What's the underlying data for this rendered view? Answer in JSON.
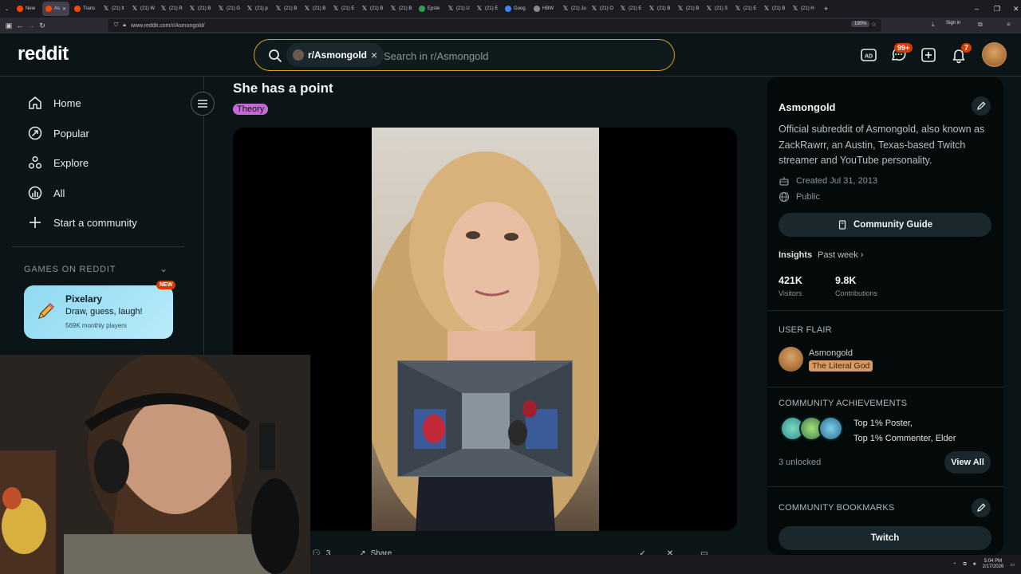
{
  "browser": {
    "tabs": [
      {
        "label": "New",
        "icon": "reddit-icon",
        "color": "#ff4500"
      },
      {
        "label": "As",
        "icon": "reddit-icon",
        "color": "#ff4500",
        "active": true
      },
      {
        "label": "Trans",
        "icon": "reddit-icon",
        "color": "#ff4500"
      },
      {
        "label": "(21) It",
        "icon": "x-icon"
      },
      {
        "label": "(21) W",
        "icon": "x-icon"
      },
      {
        "label": "(21) R",
        "icon": "x-icon"
      },
      {
        "label": "(21) B",
        "icon": "x-icon"
      },
      {
        "label": "(21) G",
        "icon": "x-icon"
      },
      {
        "label": "(21) p",
        "icon": "x-icon"
      },
      {
        "label": "(21) B",
        "icon": "x-icon"
      },
      {
        "label": "(21) B",
        "icon": "x-icon"
      },
      {
        "label": "(21) E",
        "icon": "x-icon"
      },
      {
        "label": "(21) B",
        "icon": "x-icon"
      },
      {
        "label": "(21) B",
        "icon": "x-icon"
      },
      {
        "label": "Epste",
        "icon": "doc-icon",
        "color": "#2e9e4a"
      },
      {
        "label": "(21) U",
        "icon": "x-icon"
      },
      {
        "label": "(21) E",
        "icon": "x-icon"
      },
      {
        "label": "Goog",
        "icon": "google-icon",
        "color": "#4285f4"
      },
      {
        "label": "HBW",
        "icon": "page-icon",
        "color": "#888888"
      },
      {
        "label": "(21) Ju",
        "icon": "x-icon"
      },
      {
        "label": "(21) O",
        "icon": "x-icon"
      },
      {
        "label": "(21) E",
        "icon": "x-icon"
      },
      {
        "label": "(21) B",
        "icon": "x-icon"
      },
      {
        "label": "(21) B",
        "icon": "x-icon"
      },
      {
        "label": "(21) S",
        "icon": "x-icon"
      },
      {
        "label": "(21) E",
        "icon": "x-icon"
      },
      {
        "label": "(21) B",
        "icon": "x-icon"
      },
      {
        "label": "(21) H",
        "icon": "x-icon"
      }
    ],
    "url": "www.reddit.com/r/Asmongold/",
    "zoom": "190%",
    "sign_in": "Sign in"
  },
  "header": {
    "logo": "reddit",
    "search_chip": "r/Asmongold",
    "search_placeholder": "Search in r/Asmongold",
    "chat_badge": "99+",
    "notif_badge": "7"
  },
  "leftnav": {
    "items": [
      {
        "label": "Home",
        "icon": "home-icon"
      },
      {
        "label": "Popular",
        "icon": "popular-icon"
      },
      {
        "label": "Explore",
        "icon": "explore-icon"
      },
      {
        "label": "All",
        "icon": "all-icon"
      },
      {
        "label": "Start a community",
        "icon": "plus-icon"
      }
    ],
    "games_title": "GAMES ON REDDIT",
    "game": {
      "title": "Pixelary",
      "desc": "Draw, guess, laugh!",
      "players": "569K monthly players",
      "badge": "NEW"
    }
  },
  "post": {
    "title": "She has a point",
    "flair": "Theory",
    "comments": "3",
    "share": "Share"
  },
  "sidebar": {
    "name": "Asmongold",
    "description": "Official subreddit of Asmongold, also known as ZackRawrr, an Austin, Texas-based Twitch streamer and YouTube personality.",
    "created": "Created Jul 31, 2013",
    "visibility": "Public",
    "guide_button": "Community Guide",
    "insights_label": "Insights",
    "insights_range": "Past week",
    "stats": [
      {
        "value": "421K",
        "label": "Visitors"
      },
      {
        "value": "9.8K",
        "label": "Contributions"
      }
    ],
    "flair_section": "USER FLAIR",
    "flair_user": "Asmongold",
    "flair_tag": "The Literal God",
    "achievements_section": "COMMUNITY ACHIEVEMENTS",
    "achievements_line1": "Top 1% Poster,",
    "achievements_line2": "Top 1% Commenter, Elder",
    "unlocked": "3 unlocked",
    "view_all": "View All",
    "bookmarks_section": "COMMUNITY BOOKMARKS",
    "bookmark_button": "Twitch"
  },
  "taskbar": {
    "time": "5:04 PM",
    "date": "2/17/2026"
  },
  "colors": {
    "background": "#0b1416",
    "search_border": "#d4a017",
    "flair": "#c26bd6",
    "badge": "#d93a00",
    "user_flair": "#d69a62"
  }
}
